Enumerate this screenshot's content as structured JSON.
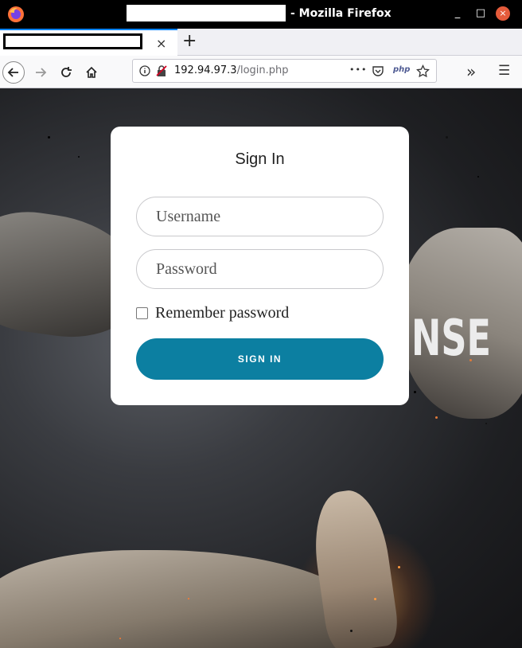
{
  "window": {
    "title_suffix": "- Mozilla Firefox",
    "minimize": "_",
    "maximize": "□",
    "close": "×"
  },
  "tabs": {
    "close_glyph": "×",
    "new_tab_glyph": "+"
  },
  "navbar": {
    "url_host": "192.94.97.3",
    "url_path": "/login.php",
    "more_glyph": "•••",
    "php_badge": "php",
    "overflow_glyph": "»",
    "menu_glyph": "☰"
  },
  "background": {
    "banner_text": "NSE"
  },
  "login": {
    "title": "Sign In",
    "username_placeholder": "Username",
    "password_placeholder": "Password",
    "remember_label": "Remember password",
    "submit_label": "SIGN IN"
  },
  "colors": {
    "accent_button": "#0c7fa1",
    "tab_highlight": "#0a84ff"
  }
}
